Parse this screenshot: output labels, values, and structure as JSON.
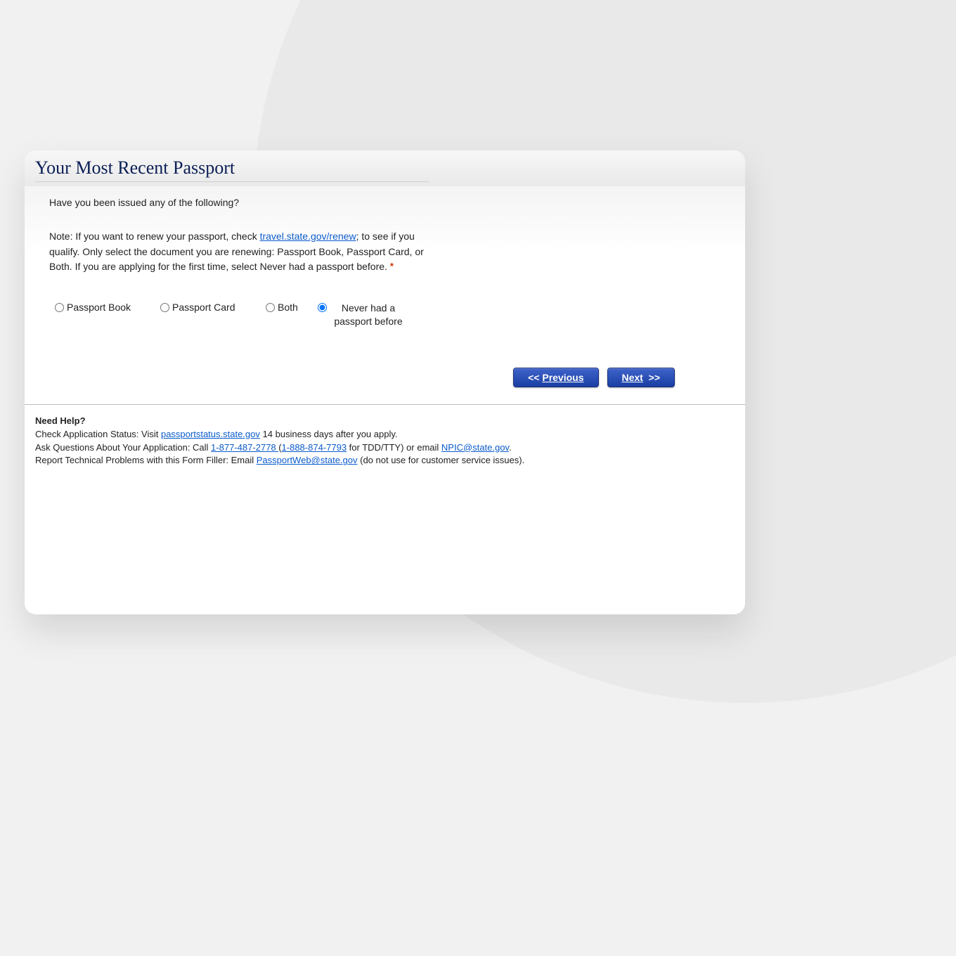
{
  "title": "Your Most Recent Passport",
  "question": "Have you been issued any of the following?",
  "note": {
    "prefix": "Note: If you want to renew your passport, check ",
    "link_text": "travel.state.gov/renew",
    "suffix": "; to see if you qualify. Only select the document you are renewing: Passport Book, Passport Card, or Both. If you are applying for the first time, select Never had a passport before."
  },
  "required_marker": "*",
  "options": {
    "book": "Passport Book",
    "card": "Passport Card",
    "both": "Both",
    "never": "Never had a passport before"
  },
  "nav": {
    "prev_chevrons": "<<",
    "prev_label": "Previous",
    "next_label": "Next",
    "next_chevrons": ">>"
  },
  "help": {
    "heading": "Need Help?",
    "status_prefix": "Check Application Status: Visit ",
    "status_link": "passportstatus.state.gov",
    "status_suffix": " 14 business days after you apply.",
    "ask_prefix": "Ask Questions About Your Application: Call ",
    "phone1": "1-877-487-2778 ",
    "phone_paren_open": "(",
    "phone2": "1-888-874-7793",
    "ask_mid": " for TDD/TTY) or email ",
    "ask_email": "NPIC@state.gov",
    "ask_suffix": ".",
    "tech_prefix": "Report Technical Problems with this Form Filler: Email ",
    "tech_email": "PassportWeb@state.gov",
    "tech_suffix": " (do not use for customer service issues)."
  }
}
